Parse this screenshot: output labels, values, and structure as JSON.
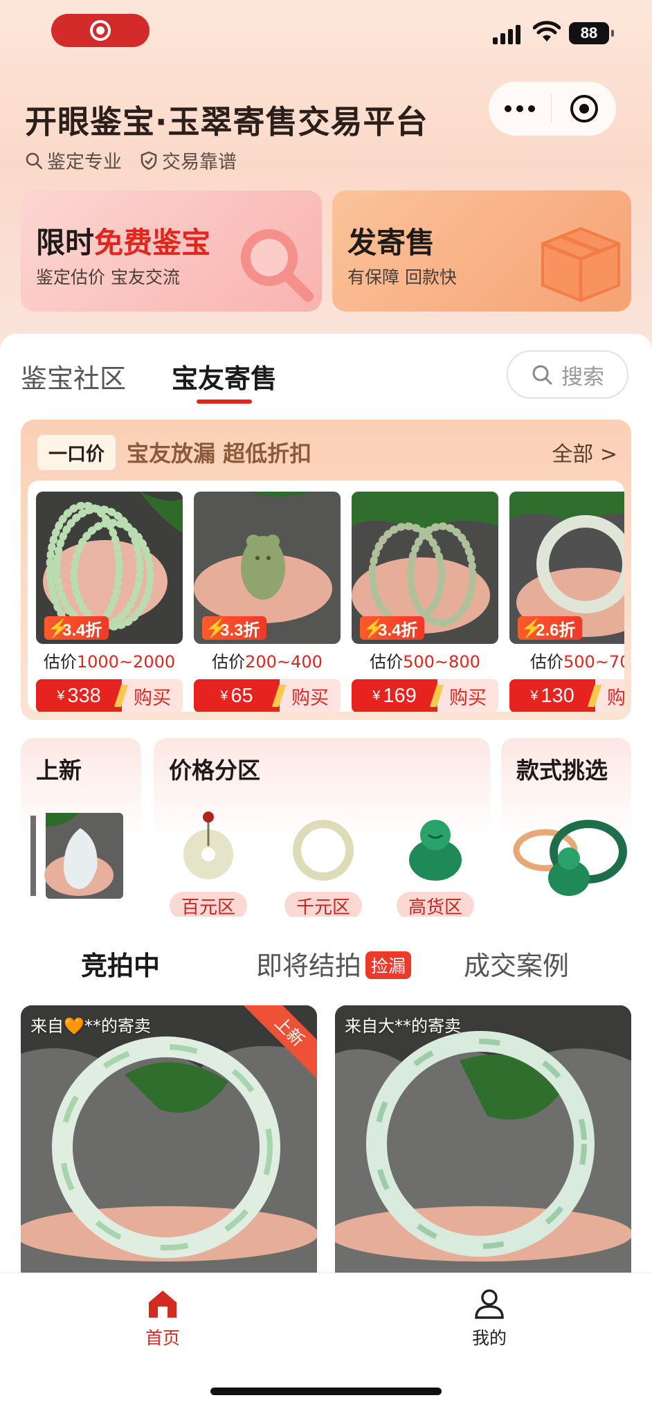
{
  "status_bar": {
    "battery": "88"
  },
  "header": {
    "title": "开眼鉴宝·玉翠寄售交易平台",
    "tags": [
      "鉴定专业",
      "交易靠谱"
    ]
  },
  "feature_cards": {
    "appraise": {
      "title_prefix": "限时",
      "title_highlight": "免费鉴宝",
      "subtitle": "鉴定估价 宝友交流"
    },
    "consign": {
      "title": "发寄售",
      "subtitle": "有保障 回款快"
    }
  },
  "tabs": [
    "鉴宝社区",
    "宝友寄售"
  ],
  "search": {
    "label": "搜索"
  },
  "flash": {
    "badge": "一口价",
    "slogan": "宝友放漏 超低折扣",
    "all_link": "全部 >",
    "currency": "¥",
    "buy_label": "购买",
    "products": [
      {
        "discount": "3.4折",
        "estimate_prefix": "估价",
        "estimate": "1000~2000",
        "price": "338"
      },
      {
        "discount": "3.3折",
        "estimate_prefix": "估价",
        "estimate": "200~400",
        "price": "65"
      },
      {
        "discount": "3.4折",
        "estimate_prefix": "估价",
        "estimate": "500~800",
        "price": "169"
      },
      {
        "discount": "2.6折",
        "estimate_prefix": "估价",
        "estimate": "500~70",
        "price": "130"
      }
    ]
  },
  "categories": {
    "new": "上新",
    "price": {
      "title": "价格分区",
      "zones": [
        "百元区",
        "千元区",
        "高货区"
      ]
    },
    "style": "款式挑选"
  },
  "auction_tabs": {
    "active": "竞拍中",
    "ending": "即将结拍",
    "ending_badge": "捡漏",
    "cases": "成交案例"
  },
  "listings": [
    {
      "from": "来自🧡**的寄卖",
      "ribbon": "上新"
    },
    {
      "from": "来自大**的寄卖"
    }
  ],
  "bottom_nav": {
    "home": "首页",
    "mine": "我的"
  },
  "colors": {
    "accent": "#e3261d",
    "bg_top": "#fbd9c9"
  }
}
